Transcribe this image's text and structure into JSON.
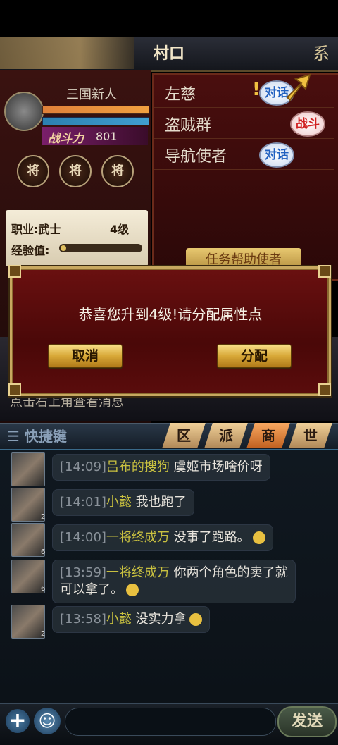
{
  "location": {
    "title": "村口",
    "system_button": "系"
  },
  "player": {
    "name": "三国新人",
    "power_label": "战斗力",
    "power_value": "801",
    "generals": [
      "将",
      "将",
      "将"
    ],
    "job": "职业:武士",
    "level": "4级",
    "exp_label": "经验值:",
    "exp_progress": 0.05
  },
  "npcs": [
    {
      "name": "左慈",
      "action": "对话",
      "quest_mark": "!"
    },
    {
      "name": "盗贼群",
      "action": "战斗"
    },
    {
      "name": "导航使者",
      "action": "对话"
    }
  ],
  "help_button": "任务帮助使者",
  "hint": "点击右上角查看消息",
  "modal": {
    "message": "恭喜您升到4级!请分配属性点",
    "cancel": "取消",
    "confirm": "分配"
  },
  "quick_chat": {
    "label": "快捷键",
    "tabs": [
      "区",
      "派",
      "商",
      "世"
    ]
  },
  "chat": [
    {
      "time": "[14:09]",
      "name": "吕布的搜狗",
      "text": "虞姬市场啥价呀",
      "level": ""
    },
    {
      "time": "[14:01]",
      "name": "小懿",
      "text": "我也跑了",
      "level": "2"
    },
    {
      "time": "[14:00]",
      "name": "一将终成万",
      "text": "没事了跑路。",
      "level": "6"
    },
    {
      "time": "[13:59]",
      "name": "一将终成万",
      "text": "你两个角色的卖了就",
      "text2": "可以拿了。",
      "level": "6"
    },
    {
      "time": "[13:58]",
      "name": "小懿",
      "text": "没实力拿",
      "level": "2"
    }
  ],
  "input": {
    "send_label": "发送",
    "plus": "+",
    "emoji": "☺"
  }
}
